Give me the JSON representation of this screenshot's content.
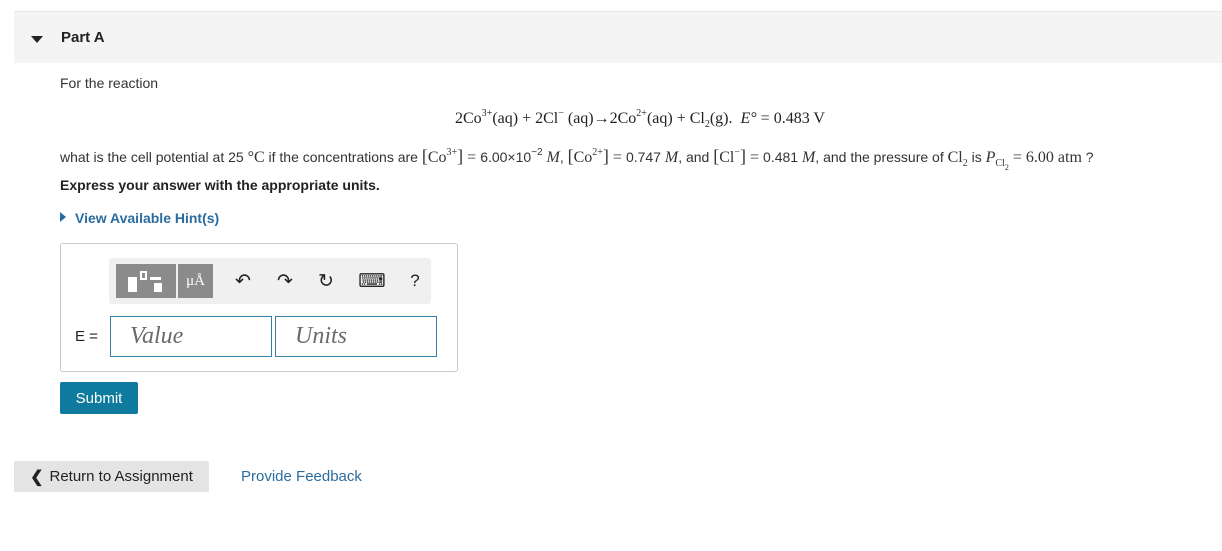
{
  "part": {
    "title": "Part A"
  },
  "problem": {
    "intro": "For the reaction",
    "eq": {
      "lhs": "2Co",
      "co3_charge": "3+",
      "aq1": "(aq)",
      "plus1": " + 2Cl",
      "cl_charge": "−",
      "aq2": " (aq)",
      "arrow": "→",
      "prod1": "2Co",
      "co2_charge": "2+",
      "aq3": "(aq)",
      "plus2": " + Cl",
      "cl2_sub": "2",
      "gas": "(g).",
      "e_symbol": "E°",
      "e_value": " = 0.483 V"
    },
    "q": {
      "p1": "what is the cell potential at 25 ",
      "deg": "°C",
      "p2": " if the concentrations are ",
      "co3_label": "Co",
      "co3_sup": "3+",
      "co3_value": "6.00×10",
      "co3_exp": "−2",
      "molar": "M",
      "co2_label": "Co",
      "co2_sup": "2+",
      "co2_value": "0.747",
      "and": ", and ",
      "cl_label": "Cl",
      "cl_sup": "−",
      "cl_value": "0.481",
      "p3": ", and the pressure of ",
      "cl2": "Cl",
      "cl2_sub": "2",
      "is": " is ",
      "p_symbol": "P",
      "p_sub": "Cl",
      "p_sub2": "2",
      "p_value": "6.00 atm",
      "end": " ?"
    },
    "instruction": "Express your answer with the appropriate units.",
    "hint": "View Available Hint(s)"
  },
  "answer": {
    "label": "E =",
    "value_placeholder": "Value",
    "units_placeholder": "Units",
    "toolbar": {
      "units_button": "μÅ",
      "undo_glyph": "↶",
      "redo_glyph": "↷",
      "reset_glyph": "↻",
      "keyboard_glyph": "⌨",
      "help": "?"
    }
  },
  "buttons": {
    "submit": "Submit",
    "return_label": "Return to Assignment",
    "feedback": "Provide Feedback"
  },
  "colors": {
    "link": "#2a6c9e",
    "submit_bg": "#0e7a9e",
    "input_border": "#3b7fa8"
  },
  "icons": [
    "caret-down-icon",
    "caret-right-icon",
    "templates-icon",
    "units-icon",
    "undo-icon",
    "redo-icon",
    "reset-icon",
    "keyboard-icon",
    "help-icon",
    "chevron-left-icon"
  ]
}
